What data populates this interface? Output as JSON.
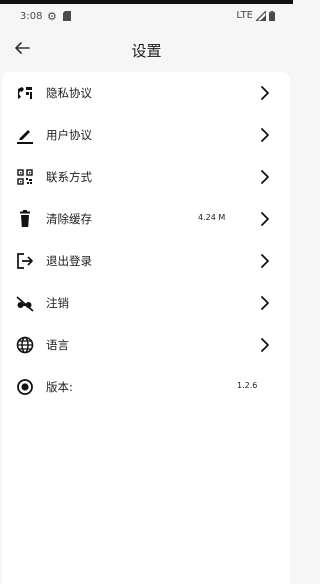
{
  "status_bar": {
    "time": "3:08",
    "network": "LTE"
  },
  "app_bar": {
    "title": "设置"
  },
  "settings": {
    "items": [
      {
        "label": "隐私协议",
        "icon": "privacy-icon"
      },
      {
        "label": "用户协议",
        "icon": "pen-icon"
      },
      {
        "label": "联系方式",
        "icon": "qr-code-icon"
      },
      {
        "label": "清除缓存",
        "icon": "trash-icon",
        "value": "4.24 M"
      },
      {
        "label": "退出登录",
        "icon": "logout-icon"
      },
      {
        "label": "注销",
        "icon": "cancel-account-icon"
      },
      {
        "label": "语言",
        "icon": "globe-icon"
      },
      {
        "label": "版本:",
        "icon": "radio-icon",
        "value": "1.2.6"
      }
    ]
  },
  "colors": {
    "background": "#f6f6f6",
    "card": "#ffffff",
    "text": "#1c1c1c"
  }
}
